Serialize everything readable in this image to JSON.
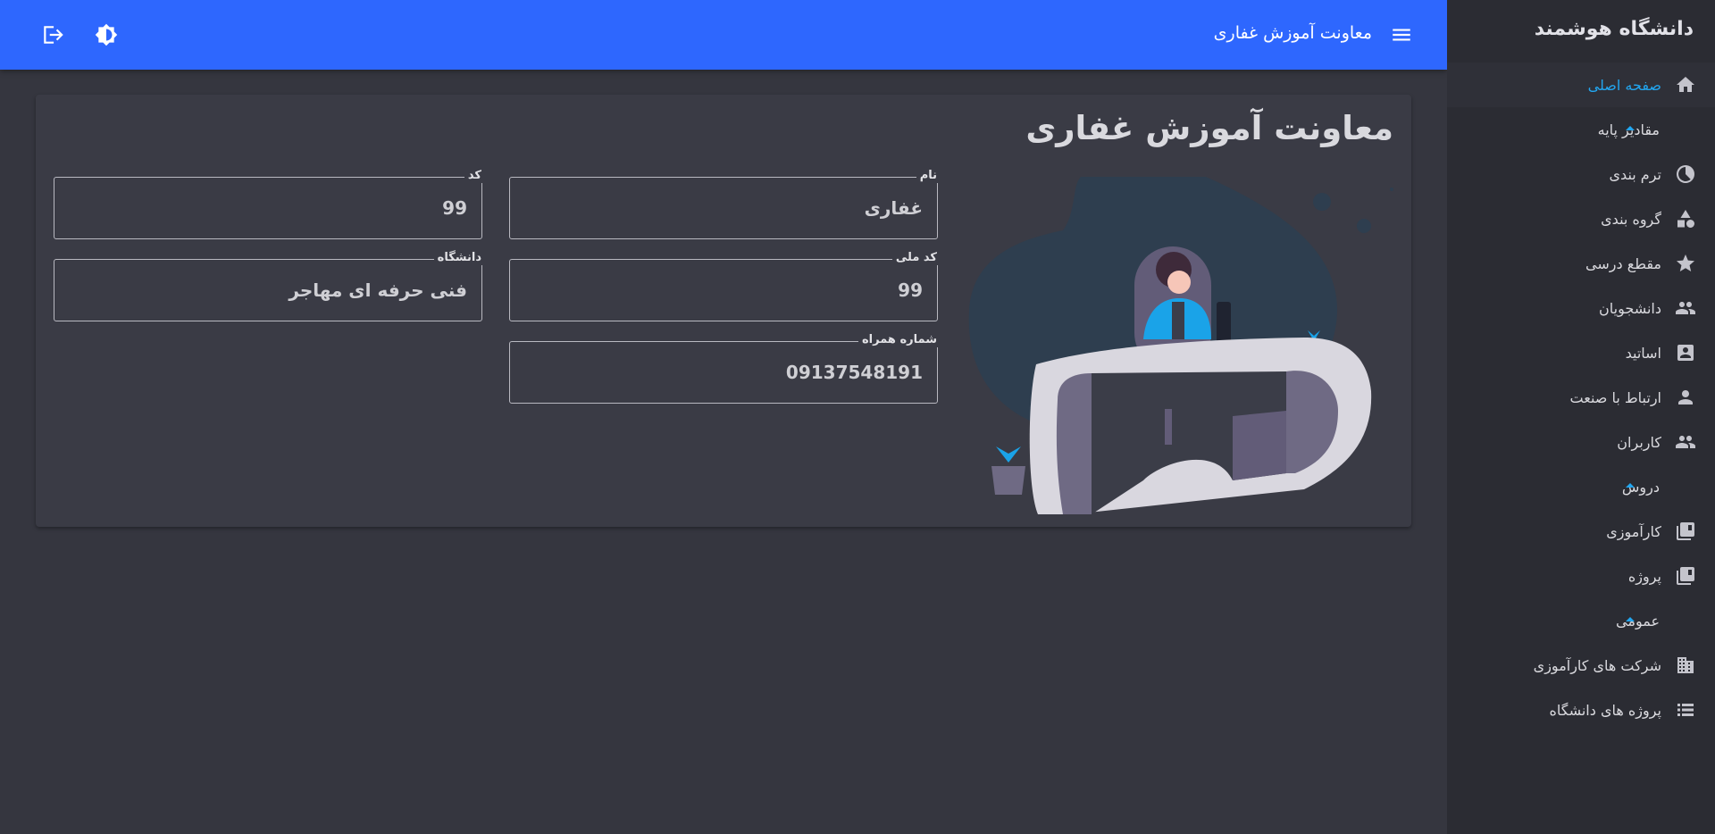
{
  "sidebar": {
    "brand": "دانشگاه هوشمند",
    "items": [
      {
        "label": "صفحه اصلی",
        "icon": "home-icon",
        "active": true
      },
      {
        "label": "مقادیر پایه",
        "group": true
      },
      {
        "label": "ترم بندی",
        "icon": "pie-chart-icon"
      },
      {
        "label": "گروه بندی",
        "icon": "shapes-icon"
      },
      {
        "label": "مقطع درسی",
        "icon": "star-icon"
      },
      {
        "label": "دانشجویان",
        "icon": "people-icon"
      },
      {
        "label": "اساتید",
        "icon": "contact-card-icon"
      },
      {
        "label": "ارتباط با صنعت",
        "icon": "person-icon"
      },
      {
        "label": "کاربران",
        "icon": "people-icon"
      },
      {
        "label": "دروس",
        "group": true
      },
      {
        "label": "کارآموزی",
        "icon": "library-books-icon"
      },
      {
        "label": "پروژه",
        "icon": "library-books-icon"
      },
      {
        "label": "عمومی",
        "group": true
      },
      {
        "label": "شرکت های کارآموزی",
        "icon": "building-icon"
      },
      {
        "label": "پروژه های دانشگاه",
        "icon": "list-icon"
      }
    ]
  },
  "topbar": {
    "title": "معاونت آموزش غفاری",
    "menu_icon": "hamburger-menu-icon",
    "theme_icon": "brightness-icon",
    "logout_icon": "logout-icon"
  },
  "card": {
    "title": "معاونت آموزش غفاری",
    "fields": {
      "name": {
        "label": "نام",
        "value": "غفاری"
      },
      "code": {
        "label": "کد",
        "value": "99"
      },
      "national_code": {
        "label": "کد ملی",
        "value": "99"
      },
      "university": {
        "label": "دانشگاه",
        "value": "فنی حرفه ای مهاجر"
      },
      "mobile": {
        "label": "شماره همراه",
        "value": "09137548191"
      }
    }
  },
  "colors": {
    "accent": "#2e67fe",
    "active_link": "#22a6f0",
    "background": "#35363f",
    "sidebar": "#2b2c33",
    "card": "#3a3b45"
  }
}
